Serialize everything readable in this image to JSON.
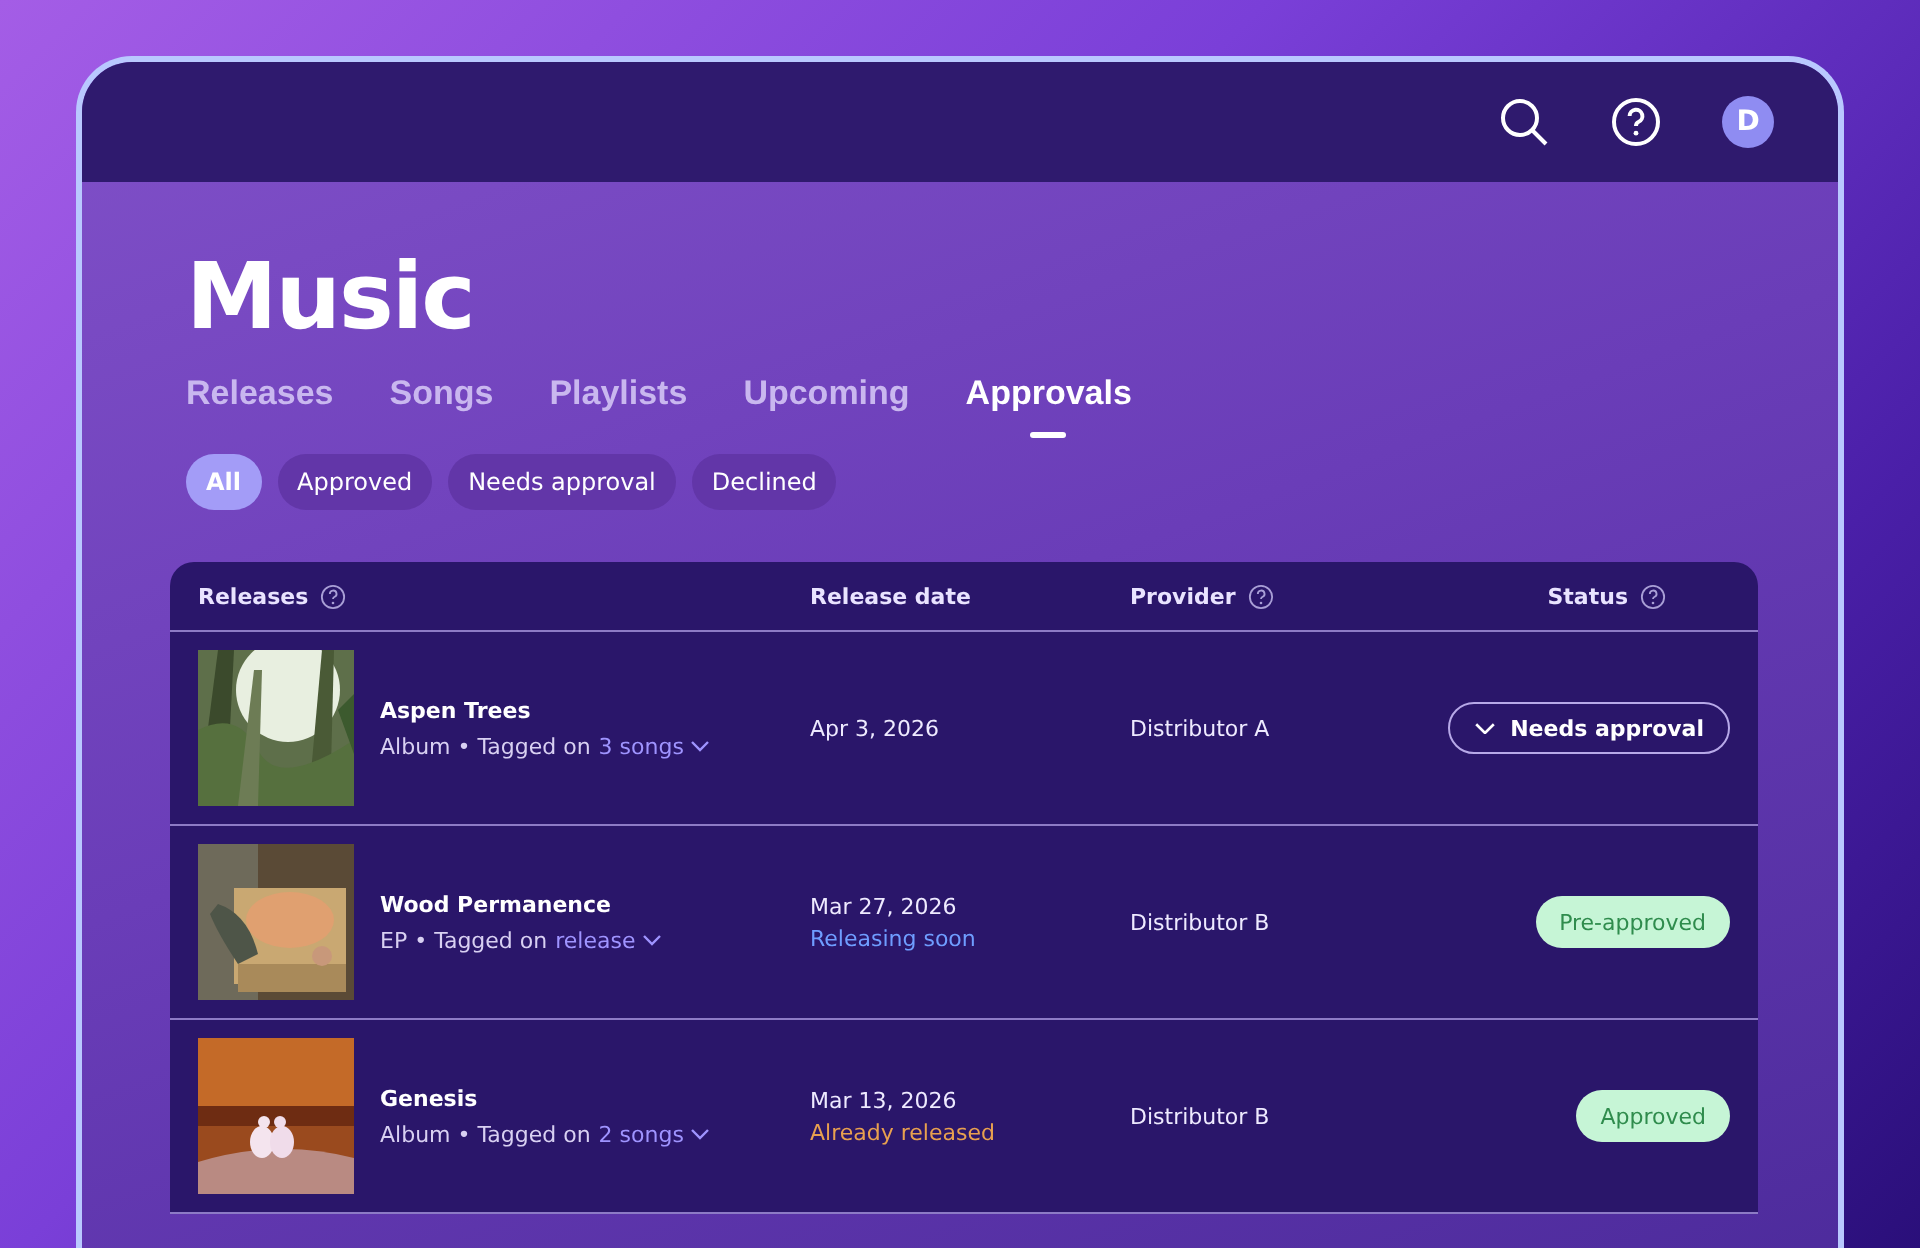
{
  "top_bar": {
    "avatar": "D"
  },
  "title": "Music",
  "tabs": [
    {
      "label": "Releases",
      "selected": false
    },
    {
      "label": "Songs",
      "selected": false
    },
    {
      "label": "Playlists",
      "selected": false
    },
    {
      "label": "Upcoming",
      "selected": false
    },
    {
      "label": "Approvals",
      "selected": true
    }
  ],
  "filters": [
    {
      "label": "All",
      "selected": true
    },
    {
      "label": "Approved",
      "selected": false
    },
    {
      "label": "Needs approval",
      "selected": false
    },
    {
      "label": "Declined",
      "selected": false
    }
  ],
  "table": {
    "columns": [
      {
        "label": "Releases",
        "help": true
      },
      {
        "label": "Release date",
        "help": false
      },
      {
        "label": "Provider",
        "help": true
      },
      {
        "label": "Status",
        "help": true
      }
    ],
    "rows": [
      {
        "name": "Aspen Trees",
        "meta": "Album • Tagged on",
        "tag_link": "3 songs",
        "date": "Apr 3, 2026",
        "provider": "Distributor A",
        "status": {
          "label": "Needs approval",
          "kind": "dropdown"
        }
      },
      {
        "name": "Wood Permanence",
        "meta": "EP • Tagged on",
        "tag_link": "release",
        "date": "Mar 27, 2026",
        "date_note": {
          "text": "Releasing soon",
          "kind": "upcoming"
        },
        "provider": "Distributor B",
        "status": {
          "label": "Pre-approved",
          "kind": "badge"
        }
      },
      {
        "name": "Genesis",
        "meta": "Album • Tagged on",
        "tag_link": "2 songs",
        "date": "Mar 13, 2026",
        "date_note": {
          "text": "Already released",
          "kind": "past"
        },
        "provider": "Distributor B",
        "status": {
          "label": "Approved",
          "kind": "badge"
        }
      }
    ]
  }
}
